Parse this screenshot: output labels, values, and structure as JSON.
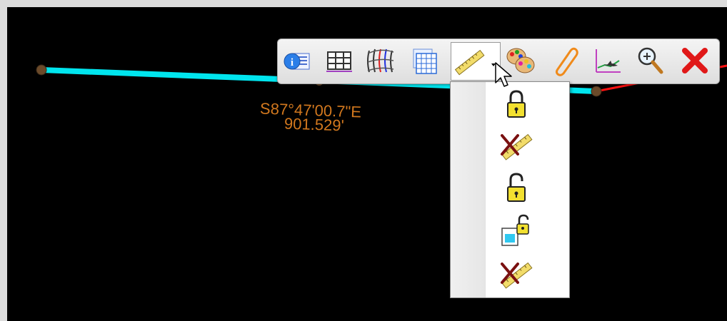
{
  "annotation": {
    "bearing": "S87°47'00.7\"E",
    "distance": "901.529'"
  },
  "colors": {
    "background": "#000000",
    "selected_line": "#00e5ee",
    "other_line": "#ff1010",
    "label": "#d2781e",
    "vertex": "#6b4a2a"
  },
  "toolbar": {
    "buttons": [
      {
        "icon": "info-icon"
      },
      {
        "icon": "table-icon"
      },
      {
        "icon": "surface-icon"
      },
      {
        "icon": "grid-icon"
      },
      {
        "icon": "ruler-icon",
        "active": true,
        "has_dropdown": true
      },
      {
        "icon": "palette-icon"
      },
      {
        "icon": "paperclip-icon"
      },
      {
        "icon": "profile-view-icon"
      },
      {
        "icon": "zoom-icon"
      },
      {
        "icon": "close-icon"
      }
    ]
  },
  "dropdown": {
    "items": [
      {
        "icon": "lock-icon"
      },
      {
        "icon": "ruler-delete-icon"
      },
      {
        "icon": "unlock-icon"
      },
      {
        "icon": "document-unlock-icon"
      },
      {
        "icon": "ruler-delete-icon"
      }
    ]
  }
}
